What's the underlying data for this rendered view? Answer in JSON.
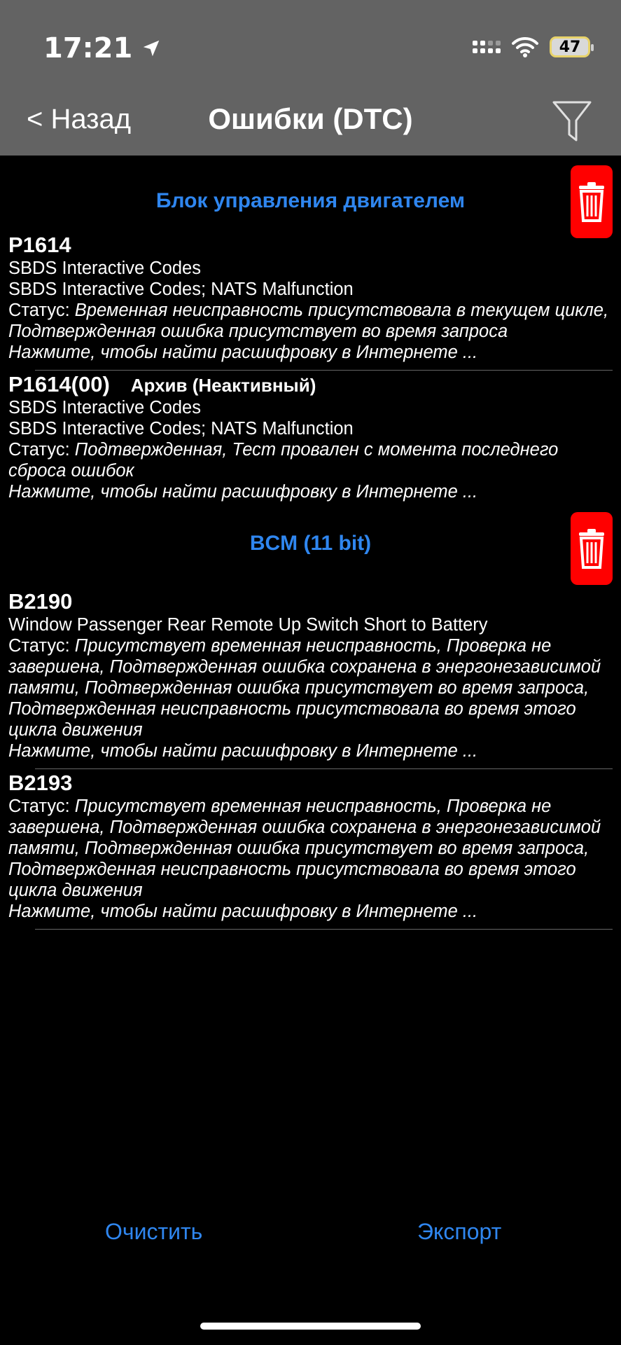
{
  "status_bar": {
    "time": "17:21",
    "battery": "47"
  },
  "nav": {
    "back_label": "< Назад",
    "title": "Ошибки (DTC)"
  },
  "sections": [
    {
      "title": "Блок управления двигателем",
      "items": [
        {
          "code": "P1614",
          "lines": [
            "SBDS Interactive Codes",
            "SBDS Interactive Codes; NATS Malfunction"
          ],
          "status_label": "Статус: ",
          "status_text": "Временная неисправность присутствовала в текущем цикле, Подтвержденная ошибка присутствует во время запроса",
          "hint": "Нажмите, чтобы найти расшифровку в Интернете ..."
        },
        {
          "code": "P1614(00)",
          "archive": "Архив (Неактивный)",
          "lines": [
            "SBDS Interactive Codes",
            "SBDS Interactive Codes; NATS Malfunction"
          ],
          "status_label": "Статус: ",
          "status_text": "Подтвержденная, Тест провален с момента последнего сброса ошибок",
          "hint": "Нажмите, чтобы найти расшифровку в Интернете ..."
        }
      ]
    },
    {
      "title": "BCM (11 bit)",
      "items": [
        {
          "code": "B2190",
          "lines": [
            "Window Passenger Rear Remote Up Switch Short to Battery"
          ],
          "status_label": "Статус: ",
          "status_text": "Присутствует временная неисправность, Проверка не завершена, Подтвержденная ошибка сохранена в энергонезависимой памяти, Подтвержденная ошибка присутствует во время запроса, Подтвержденная неисправность присутствовала во время этого цикла движения",
          "hint": "Нажмите, чтобы найти расшифровку в Интернете ..."
        },
        {
          "code": "B2193",
          "lines": [],
          "status_label": "Статус: ",
          "status_text": "Присутствует временная неисправность, Проверка не завершена, Подтвержденная ошибка сохранена в энергонезависимой памяти, Подтвержденная ошибка присутствует во время запроса, Подтвержденная неисправность присутствовала во время этого цикла движения",
          "hint": "Нажмите, чтобы найти расшифровку в Интернете ..."
        }
      ]
    }
  ],
  "bottom": {
    "clear_label": "Очистить",
    "export_label": "Экспорт"
  },
  "colors": {
    "accent": "#2f86ef",
    "navbar": "#636363",
    "trash": "#ff0000"
  }
}
